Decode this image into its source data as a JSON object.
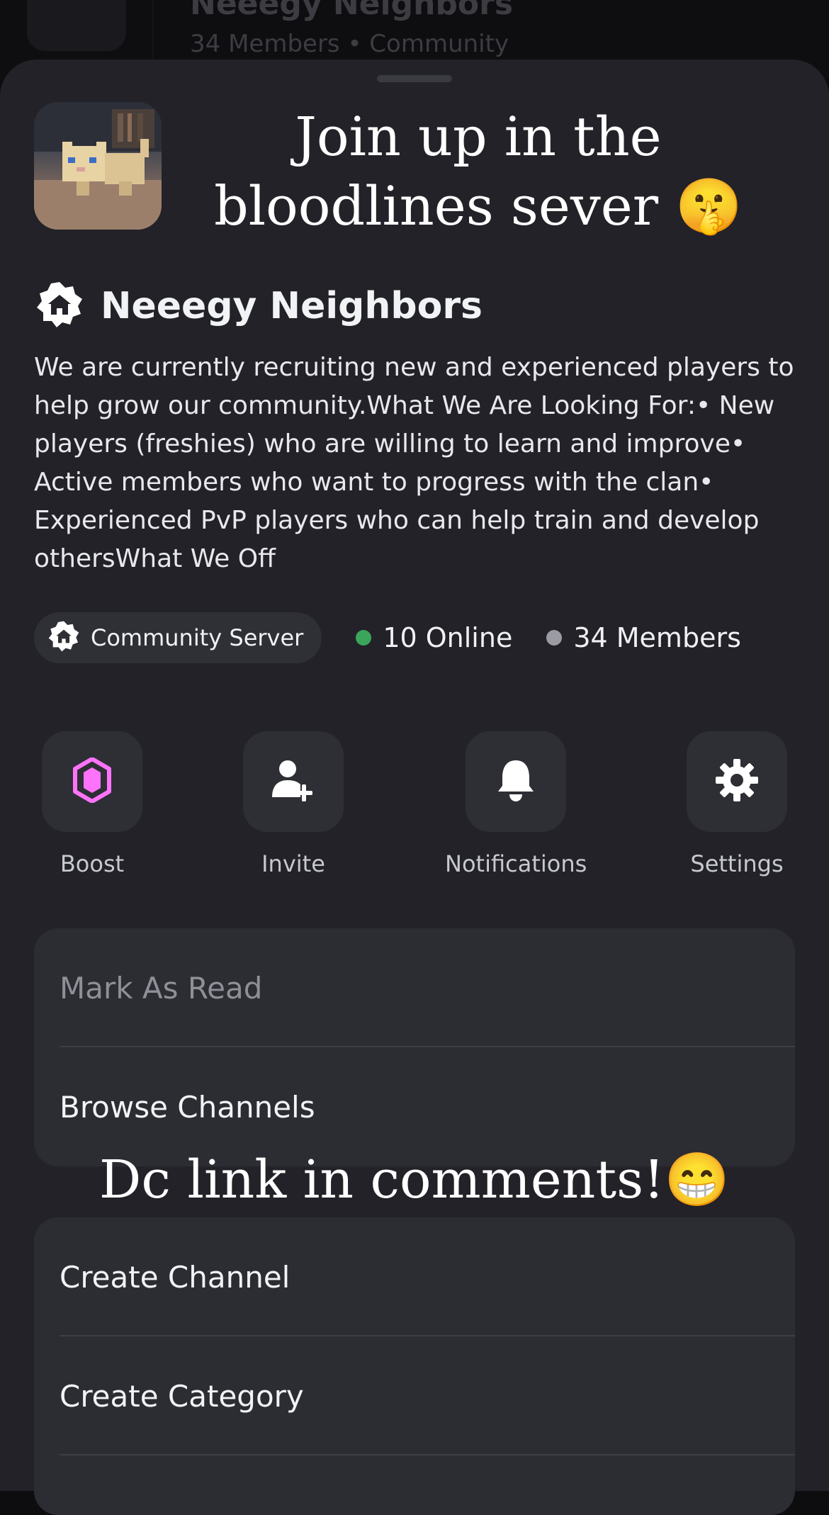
{
  "background": {
    "title": "Neeegy Neighbors",
    "subtitle": "34 Members • Community"
  },
  "overlay": {
    "top_text": "Join up in the bloodlines sever 🤫",
    "mid_text": "Dc link in comments!😁"
  },
  "server": {
    "name": "Neeegy Neighbors",
    "description": "We are currently recruiting new and experienced players to help grow our community.What We Are Looking For:• New players (freshies) who are willing to learn and improve• Active members who want to progress with the clan• Experienced PvP players who can help train and develop othersWhat We Off",
    "badge_label": "Community Server",
    "online": "10 Online",
    "members": "34 Members"
  },
  "actions": [
    {
      "label": "Boost",
      "icon": "boost-gem-icon"
    },
    {
      "label": "Invite",
      "icon": "add-user-icon"
    },
    {
      "label": "Notifications",
      "icon": "bell-icon"
    },
    {
      "label": "Settings",
      "icon": "gear-icon"
    }
  ],
  "menu_group_1": [
    {
      "label": "Mark As Read"
    },
    {
      "label": "Browse Channels"
    }
  ],
  "menu_group_2": [
    {
      "label": "Create Channel"
    },
    {
      "label": "Create Category"
    }
  ],
  "colors": {
    "online": "#3ba55c",
    "members": "#9b9ca3",
    "boost": "#ff73fa",
    "sheet": "#222228"
  }
}
